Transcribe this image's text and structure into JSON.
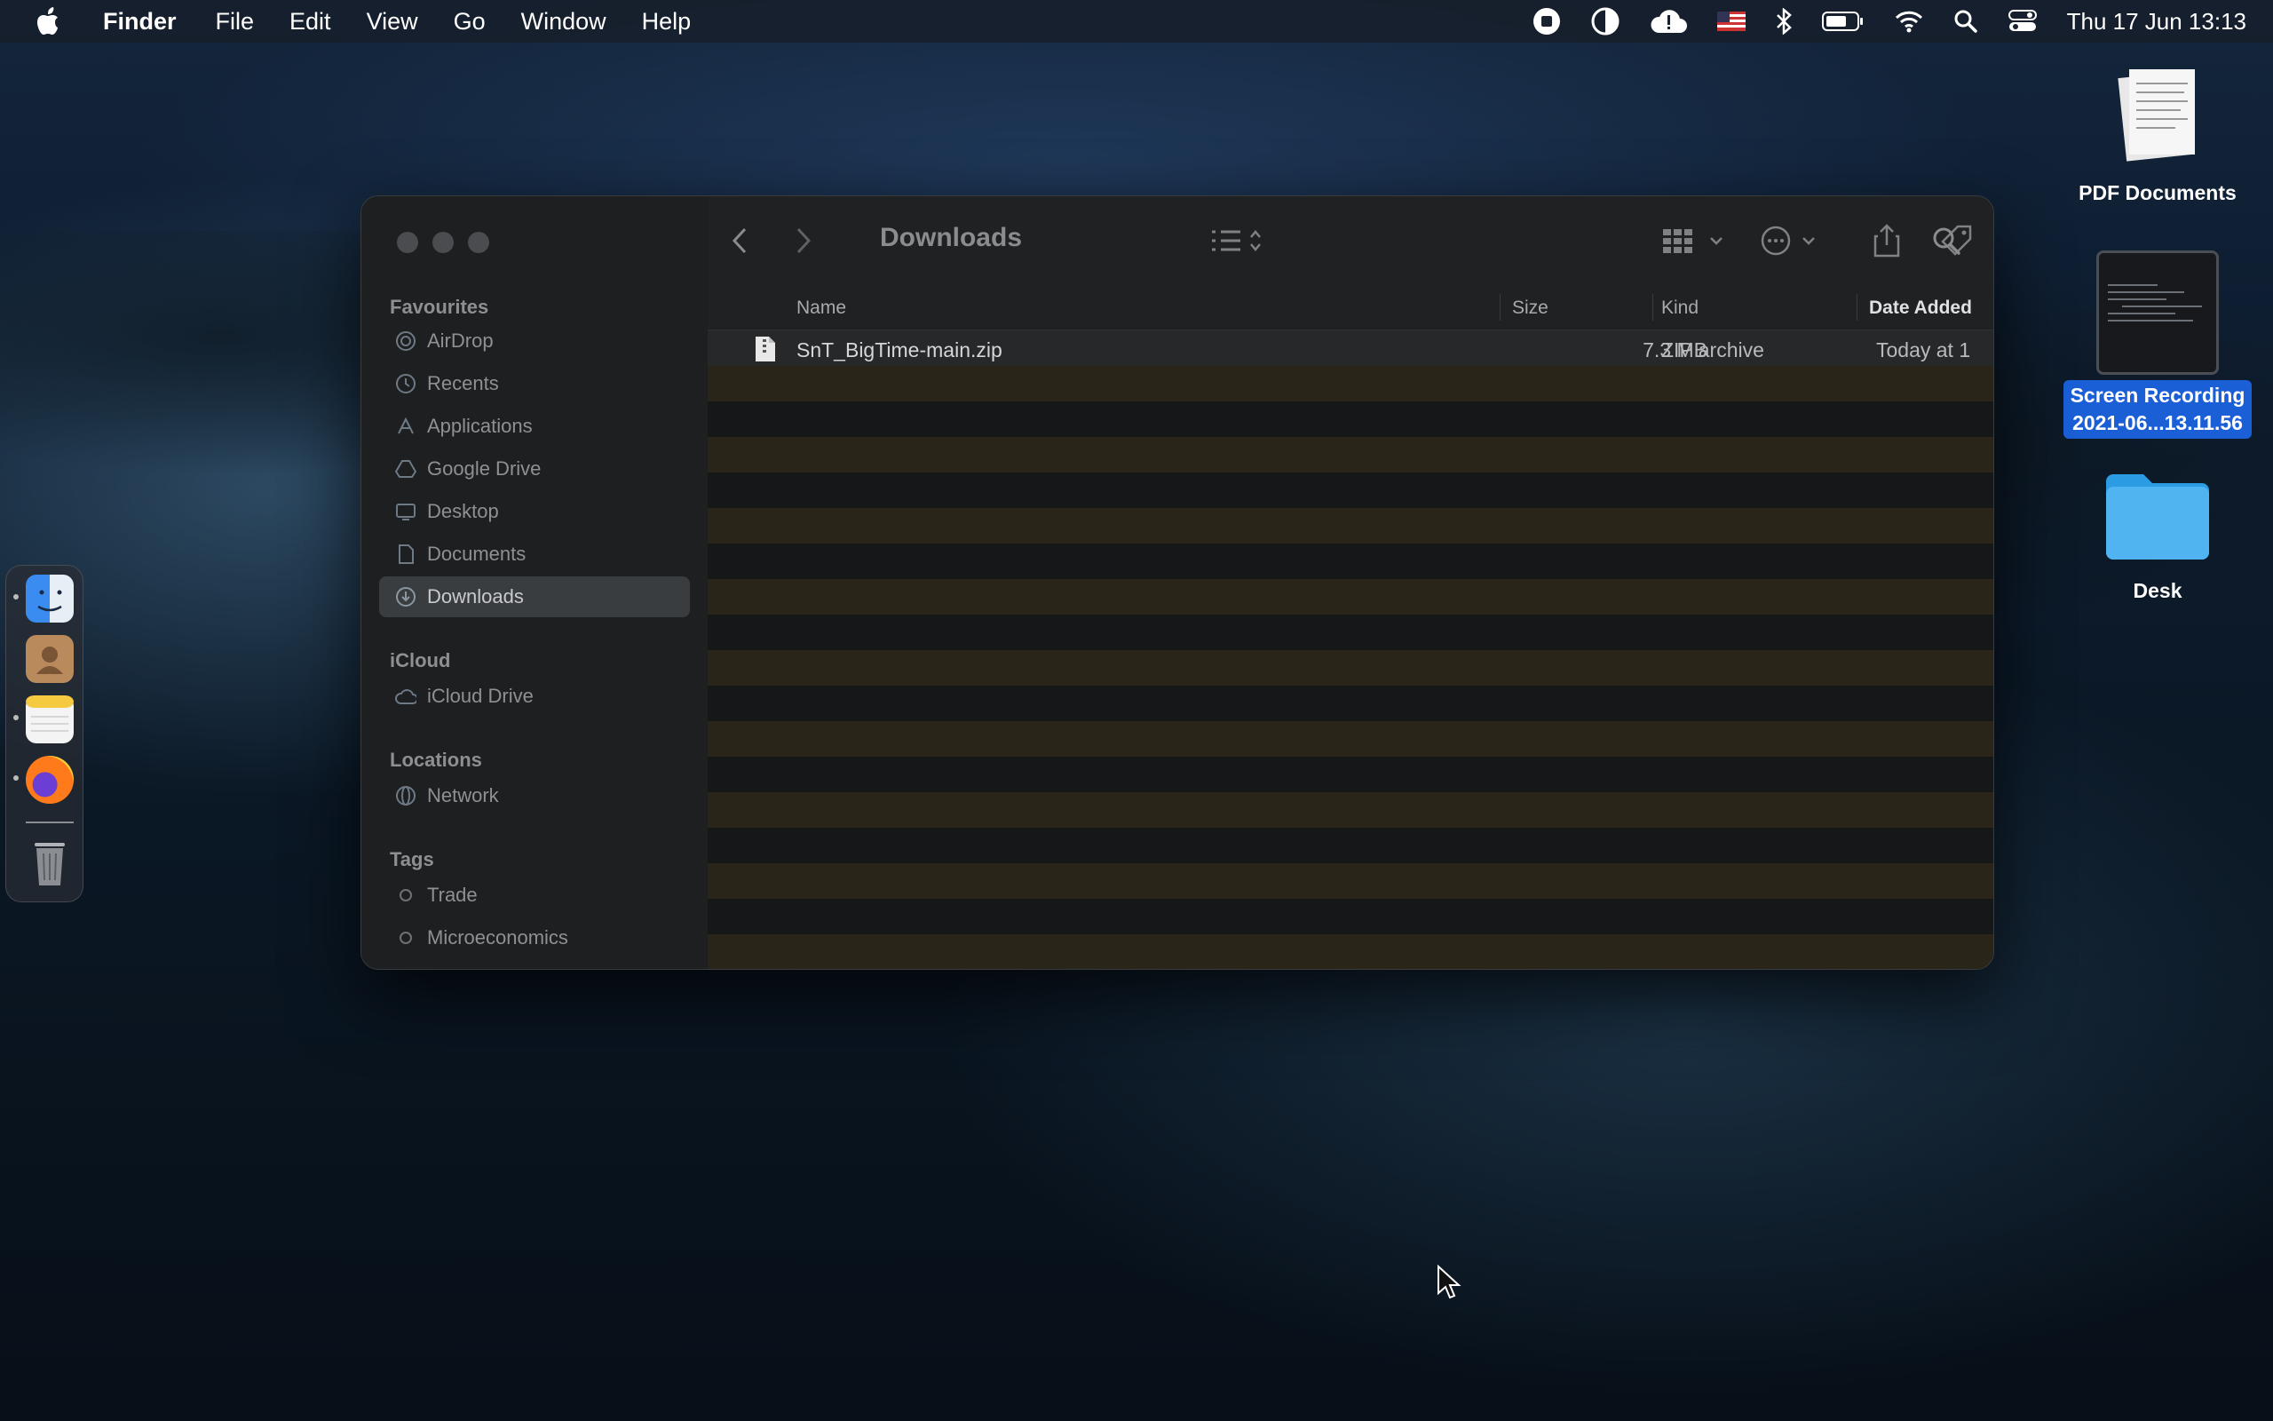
{
  "menubar": {
    "app_name": "Finder",
    "menus": [
      "File",
      "Edit",
      "View",
      "Go",
      "Window",
      "Help"
    ],
    "clock": "Thu 17 Jun  13:13",
    "icons": [
      "apple-icon",
      "screen-record-stop-icon",
      "half-circle-icon",
      "cloud-alert-icon",
      "flag-us-icon",
      "bluetooth-icon",
      "battery-icon",
      "wifi-icon",
      "spotlight-search-icon",
      "control-center-icon"
    ]
  },
  "window": {
    "title": "Downloads",
    "sidebar": {
      "favourites_label": "Favourites",
      "favourites": [
        "AirDrop",
        "Recents",
        "Applications",
        "Google Drive",
        "Desktop",
        "Documents",
        "Downloads"
      ],
      "icloud_label": "iCloud",
      "icloud": [
        "iCloud Drive"
      ],
      "locations_label": "Locations",
      "locations": [
        "Network"
      ],
      "tags_label": "Tags",
      "tags": [
        "Trade",
        "Microeconomics"
      ]
    },
    "columns": {
      "name": "Name",
      "size": "Size",
      "kind": "Kind",
      "date": "Date Added"
    },
    "files": [
      {
        "name": "SnT_BigTime-main.zip",
        "size": "7.3 MB",
        "kind": "ZIP archive",
        "date": "Today at 1"
      }
    ]
  },
  "desktop": {
    "icons": [
      {
        "label": "PDF Documents"
      },
      {
        "label_line1": "Screen Recording",
        "label_line2": "2021-06...13.11.56"
      },
      {
        "label": "Desk"
      }
    ]
  },
  "dock": {
    "apps": [
      "Finder",
      "Contacts",
      "Notes",
      "Firefox",
      "Trash"
    ]
  }
}
